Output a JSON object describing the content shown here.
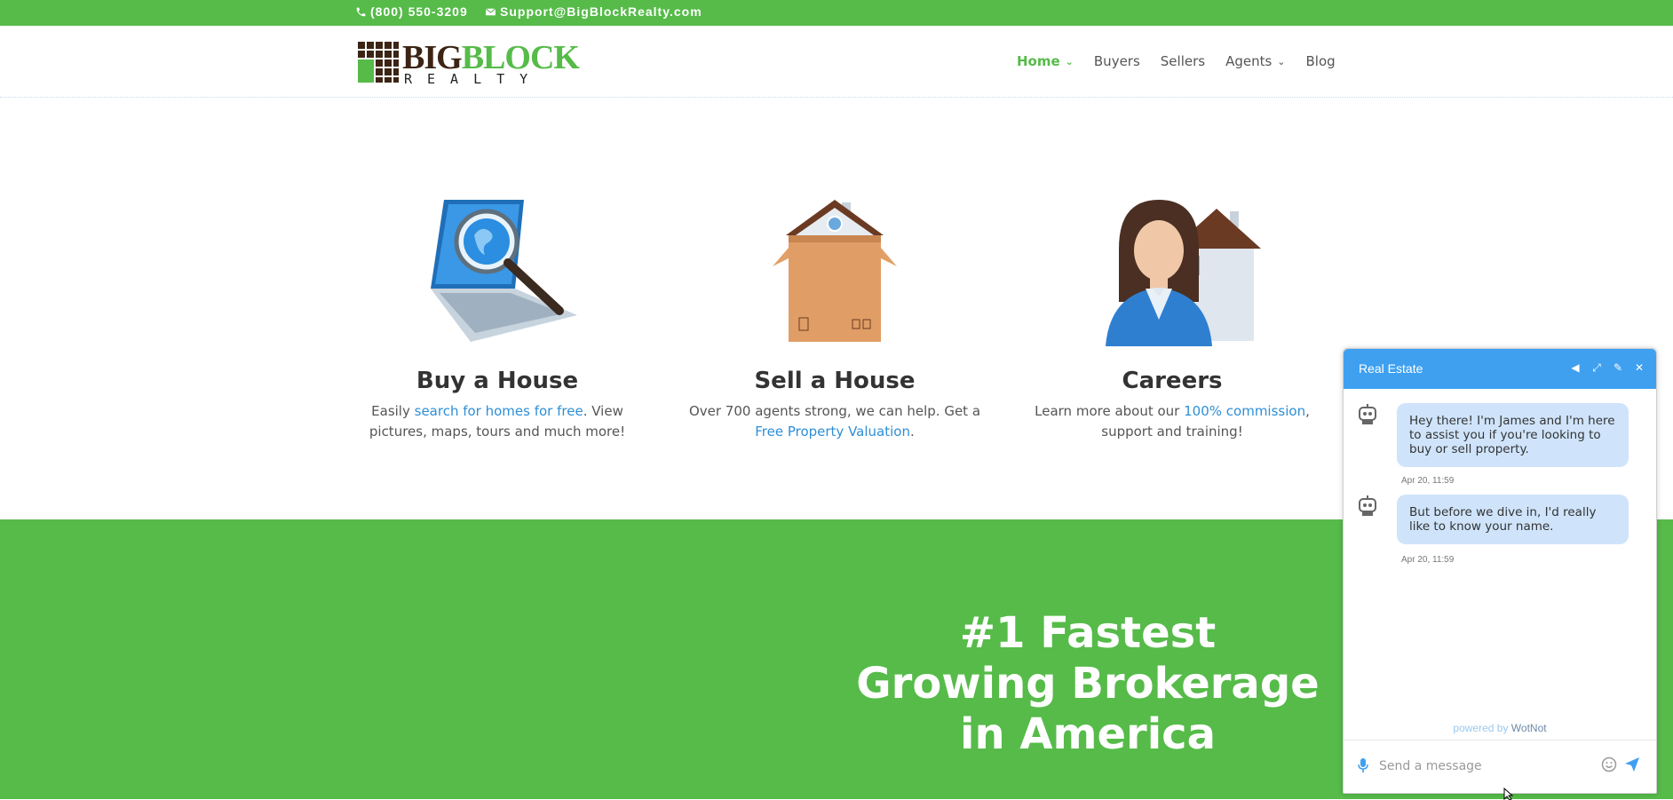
{
  "topbar": {
    "phone": "(800) 550-3209",
    "email": "Support@BigBlockRealty.com",
    "icons": [
      "phone-icon",
      "mail-icon"
    ]
  },
  "logo": {
    "word_big": "BIG",
    "word_block": "BLOCK",
    "word_realty": "REALTY"
  },
  "nav": {
    "items": [
      {
        "label": "Home",
        "active": true,
        "dropdown": true
      },
      {
        "label": "Buyers",
        "active": false,
        "dropdown": false
      },
      {
        "label": "Sellers",
        "active": false,
        "dropdown": false
      },
      {
        "label": "Agents",
        "active": false,
        "dropdown": true
      },
      {
        "label": "Blog",
        "active": false,
        "dropdown": false
      }
    ],
    "chevron": "⌄"
  },
  "features": {
    "buy": {
      "title": "Buy a House",
      "text_pre": "Easily ",
      "link": "search for homes for free",
      "text_post": ". View pictures, maps, tours and much more!"
    },
    "sell": {
      "title": "Sell a House",
      "text_pre": "Over 700 agents strong, we can help. Get a ",
      "link": "Free Property Valuation",
      "text_post": "."
    },
    "careers": {
      "title": "Careers",
      "text_pre": "Learn more about our ",
      "link": "100% commission",
      "text_post": ", support and training!"
    }
  },
  "band": {
    "headline": "#1 Fastest Growing Brokerage in America"
  },
  "chat": {
    "title": "Real Estate",
    "header_icons": [
      "speaker-icon",
      "expand-icon",
      "edit-icon",
      "close-icon"
    ],
    "messages": [
      {
        "text": "Hey there! I'm James and I'm here to assist you if you're looking to buy or sell property.",
        "time": "Apr 20, 11:59"
      },
      {
        "text": "But before we dive in, I'd really like to know your name.",
        "time": "Apr 20, 11:59"
      }
    ],
    "powered_pre": "powered by ",
    "powered_brand": "WotNot",
    "input_placeholder": "Send a message"
  },
  "colors": {
    "brand_green": "#56bb49",
    "chat_blue": "#3fa0f0",
    "link_blue": "#2e8fd6",
    "bubble": "#cfe4fb"
  }
}
